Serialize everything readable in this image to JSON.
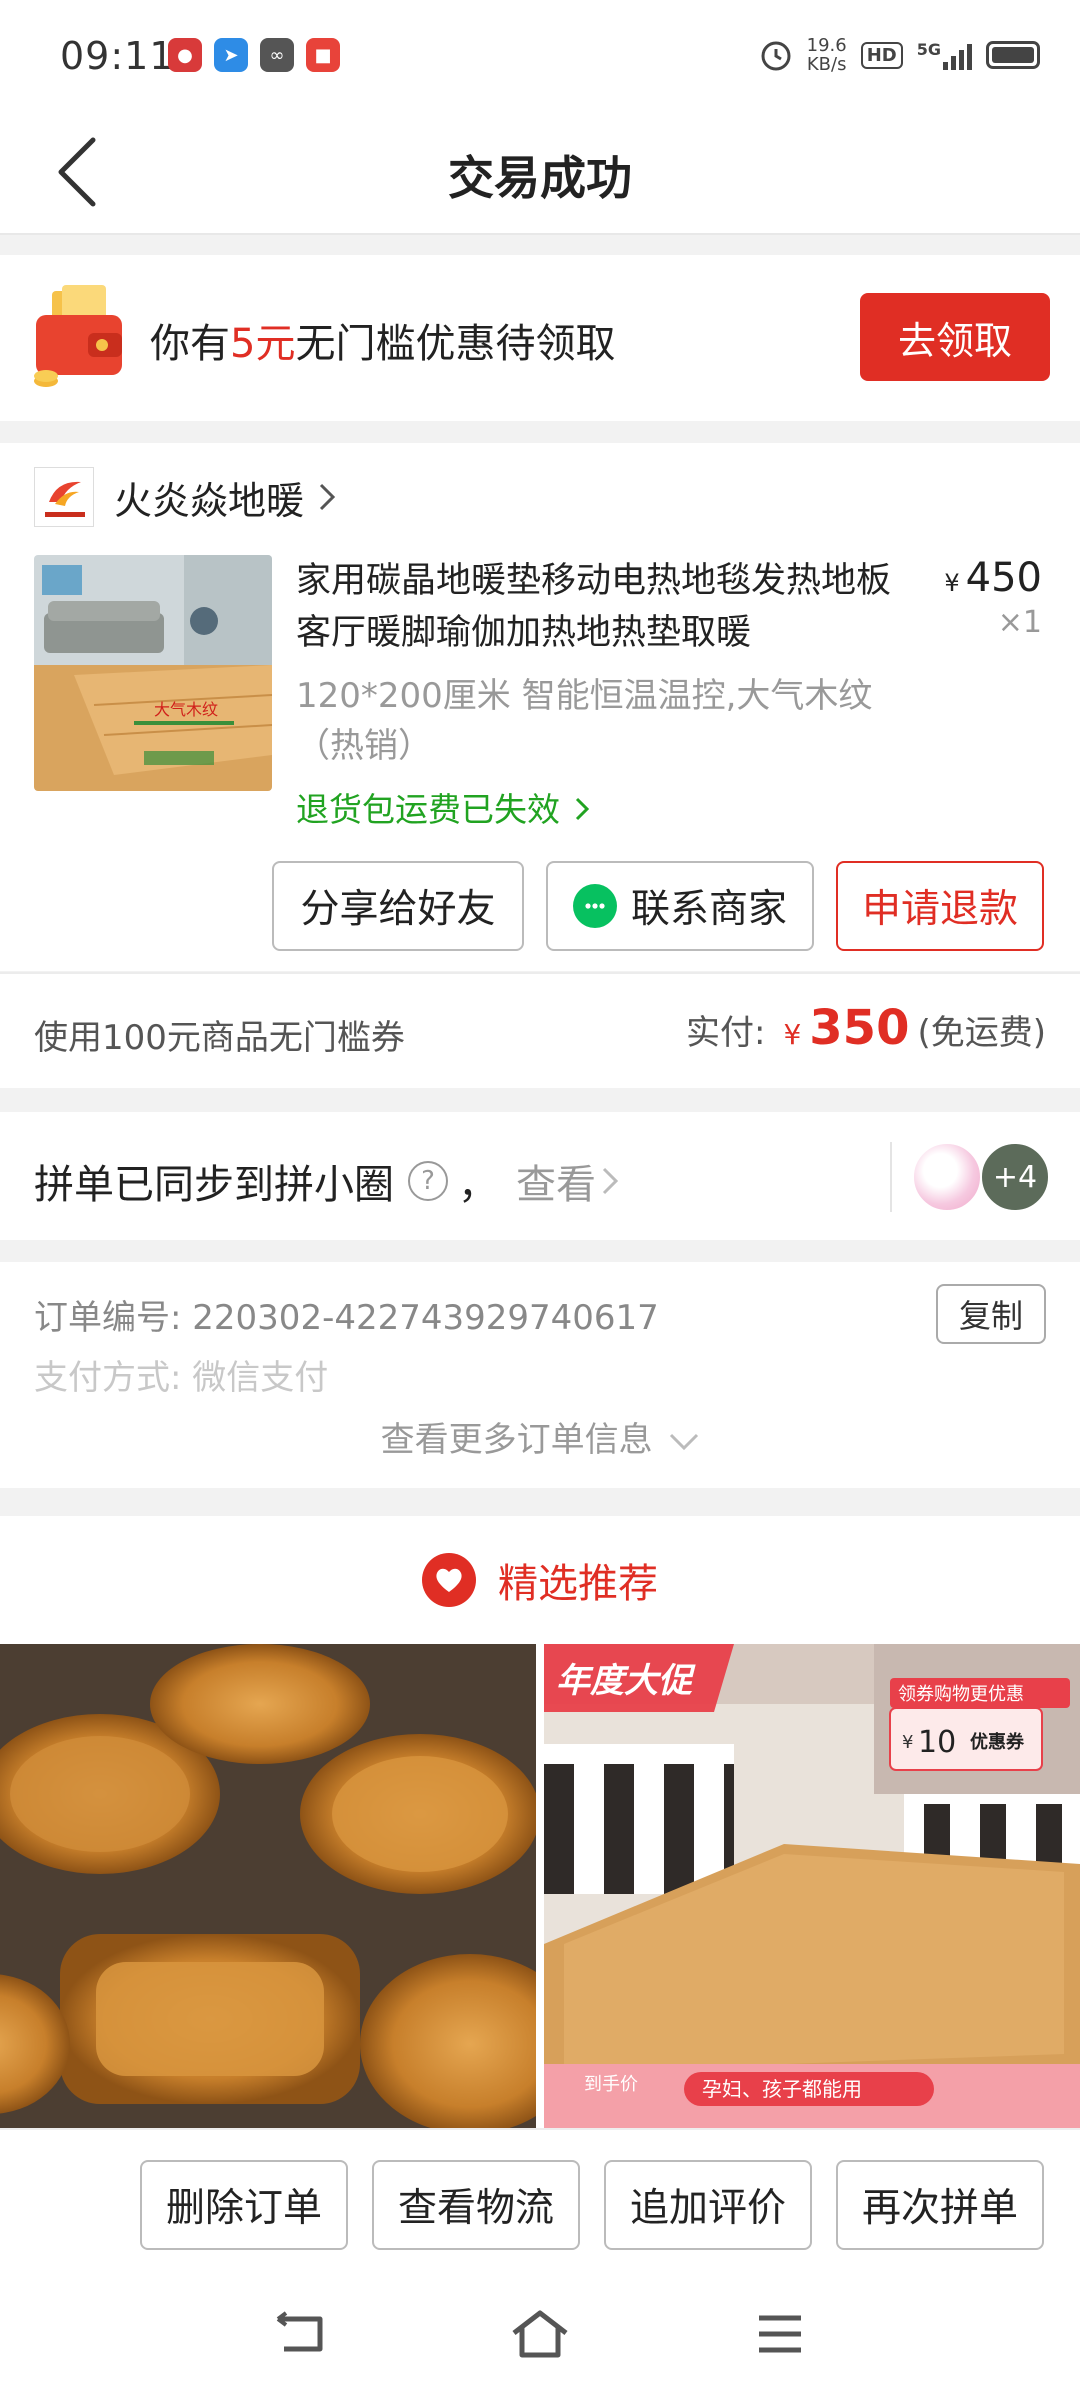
{
  "status_bar": {
    "time": "09:11",
    "net_speed_value": "19.6",
    "net_speed_unit": "KB/s",
    "hd": "HD",
    "network": "5G"
  },
  "nav": {
    "title": "交易成功"
  },
  "coupon": {
    "prefix": "你有",
    "amount": "5元",
    "suffix": "无门槛优惠待领取",
    "claim_label": "去领取"
  },
  "order": {
    "store_name": "火炎焱地暖",
    "product_title": "家用碳晶地暖垫移动电热地毯发热地板客厅暖脚瑜伽加热地热垫取暖",
    "price_symbol": "¥",
    "price": "450",
    "quantity": "×1",
    "spec": "120*200厘米 智能恒温温控,大气木纹（热销）",
    "return_note": "退货包运费已失效",
    "image_caption": "大气木纹",
    "actions": {
      "share": "分享给好友",
      "contact": "联系商家",
      "refund": "申请退款"
    }
  },
  "payment": {
    "coupon_used": "使用100元商品无门槛券",
    "paid_label": "实付:",
    "currency": "¥",
    "amount": "350",
    "shipping_note": "(免运费)"
  },
  "group": {
    "sync_text": "拼单已同步到拼小圈",
    "comma": "，",
    "view_label": "查看",
    "extra_count": "+4"
  },
  "order_info": {
    "order_no_label": "订单编号:",
    "order_no": "220302-422743929740617",
    "copy_label": "复制",
    "pay_method_label": "支付方式:",
    "pay_method": "微信支付",
    "more_label": "查看更多订单信息"
  },
  "recommend": {
    "title": "精选推荐",
    "right_item": {
      "banner": "年度大促",
      "coupon_tag": "领券购物更优惠",
      "coupon_currency": "¥",
      "coupon_amount": "10",
      "coupon_word": "优惠券",
      "price_label": "到手价",
      "slogan": "孕妇、孩子都能用"
    }
  },
  "bottom_actions": {
    "delete": "删除订单",
    "logistics": "查看物流",
    "review": "追加评价",
    "reorder": "再次拼单"
  },
  "colors": {
    "accent": "#e02e24",
    "success": "#21a321",
    "wechat": "#07c160"
  }
}
